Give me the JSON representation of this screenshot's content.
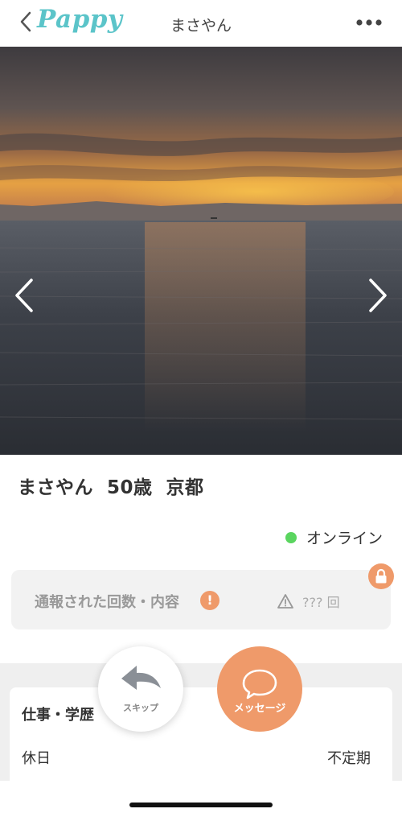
{
  "header": {
    "logo": "Pappy",
    "title": "まさやん",
    "back_icon": "chevron-left-icon",
    "more_icon": "more-dots-icon"
  },
  "photo": {
    "description_icon": "sunset-sea-photo",
    "prev_icon": "chevron-left-icon",
    "next_icon": "chevron-right-icon"
  },
  "profile": {
    "name": "まさやん",
    "age": "50歳",
    "location": "京都"
  },
  "status": {
    "online_label": "オンライン",
    "online_color": "#5ad55f"
  },
  "report": {
    "label": "通報された回数・内容",
    "warn_glyph": "!",
    "count_text": "??? 回"
  },
  "actions": {
    "skip_label": "スキップ",
    "message_label": "メッセージ",
    "accent_color": "#ef9a6a"
  },
  "card": {
    "section_title": "仕事・学歴",
    "rows": [
      {
        "key": "休日",
        "value": "不定期"
      }
    ]
  }
}
